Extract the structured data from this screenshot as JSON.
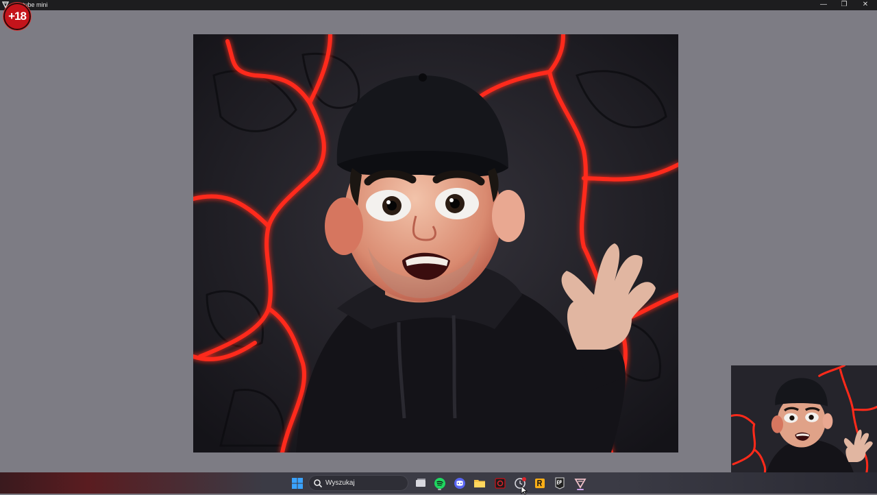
{
  "titlebar": {
    "title": "tube mini",
    "controls": {
      "minimize": "—",
      "restore": "❐",
      "close": "✕"
    }
  },
  "badge": {
    "text": "+18"
  },
  "taskbar": {
    "search_label": "Wyszukaj",
    "apps": [
      "windows-start",
      "task-view",
      "spotify",
      "discord",
      "file-explorer",
      "red-app",
      "clock-app",
      "rockstar",
      "epic-games",
      "tube-mini"
    ]
  },
  "colors": {
    "background": "#7d7c84",
    "accent_red": "#ff2a1a",
    "taskbar": "#3b3b45"
  }
}
